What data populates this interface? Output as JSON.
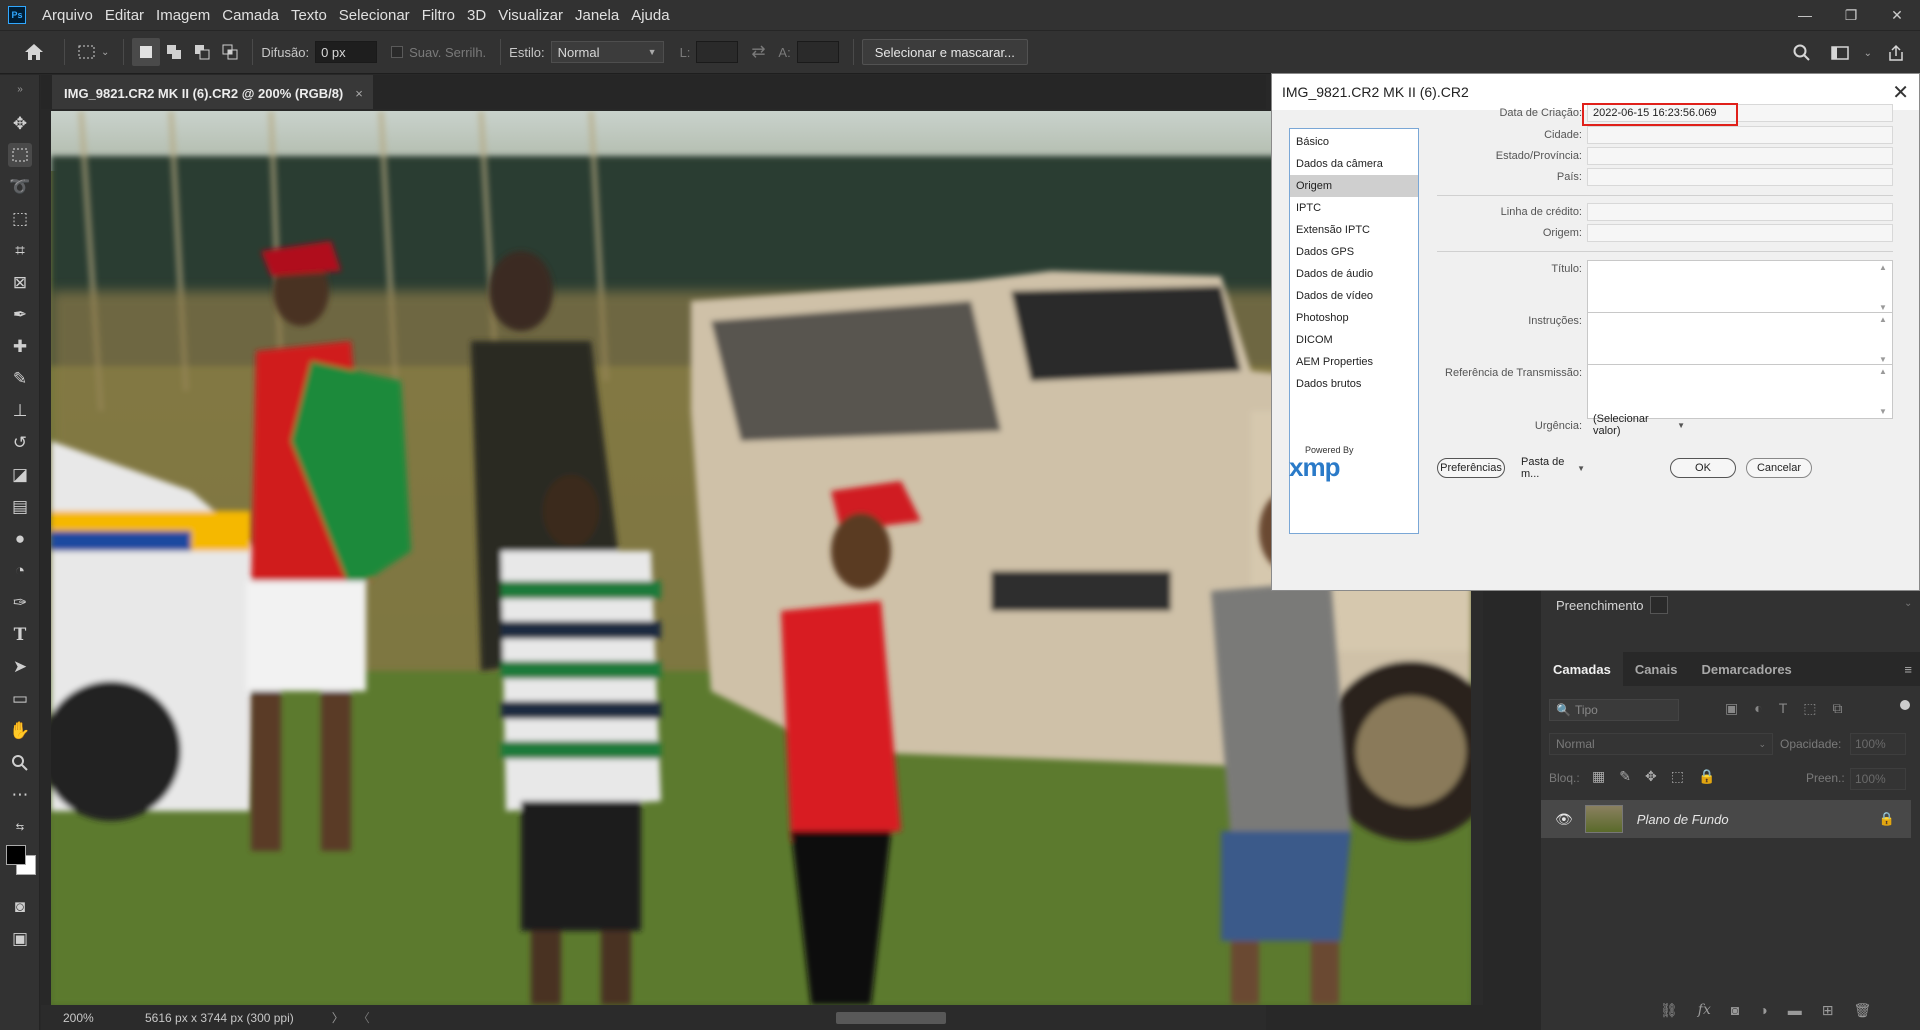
{
  "app": {
    "logo": "Ps",
    "menu": [
      "Arquivo",
      "Editar",
      "Imagem",
      "Camada",
      "Texto",
      "Selecionar",
      "Filtro",
      "3D",
      "Visualizar",
      "Janela",
      "Ajuda"
    ],
    "window_controls": {
      "minimize": "—",
      "restore": "❐",
      "close": "✕"
    }
  },
  "options": {
    "difusao_label": "Difusão:",
    "difusao_value": "0 px",
    "suav_label": "Suav. Serrilh.",
    "estilo_label": "Estilo:",
    "estilo_value": "Normal",
    "l_label": "L:",
    "a_label": "A:",
    "select_mask_button": "Selecionar e mascarar..."
  },
  "document": {
    "tab_title": "IMG_9821.CR2 MK II (6).CR2 @ 200% (RGB/8)",
    "close": "×",
    "zoom": "200%",
    "info": "5616 px x 3744 px (300 ppi)"
  },
  "dialog": {
    "title": "IMG_9821.CR2 MK II (6).CR2",
    "close": "✕",
    "categories": [
      "Básico",
      "Dados da câmera",
      "Origem",
      "IPTC",
      "Extensão IPTC",
      "Dados GPS",
      "Dados de áudio",
      "Dados de vídeo",
      "Photoshop",
      "DICOM",
      "AEM Properties",
      "Dados brutos"
    ],
    "selected_category": "Origem",
    "fields": {
      "data_criacao_label": "Data de Criação:",
      "data_criacao_value": "2022-06-15 16:23:56.069",
      "cidade_label": "Cidade:",
      "estado_label": "Estado/Província:",
      "pais_label": "País:",
      "linha_credito_label": "Linha de crédito:",
      "origem_label": "Origem:",
      "titulo_label": "Título:",
      "instrucoes_label": "Instruções:",
      "referencia_label": "Referência de Transmissão:",
      "urgencia_label": "Urgência:",
      "urgencia_value": "(Selecionar valor)"
    },
    "powered_by": "Powered By",
    "xmp": "xmp",
    "preferences_button": "Preferências",
    "folder_select": "Pasta de m...",
    "ok_button": "OK",
    "cancel_button": "Cancelar"
  },
  "panel": {
    "preenchimento_label": "Preenchimento",
    "tabs": [
      "Camadas",
      "Canais",
      "Demarcadores"
    ],
    "filter_placeholder": "Tipo",
    "blend_mode": "Normal",
    "opacity_label": "Opacidade:",
    "opacity_value": "100%",
    "lock_label": "Bloq.:",
    "fill_label": "Preen.:",
    "fill_value": "100%",
    "layer_name": "Plano de Fundo"
  }
}
